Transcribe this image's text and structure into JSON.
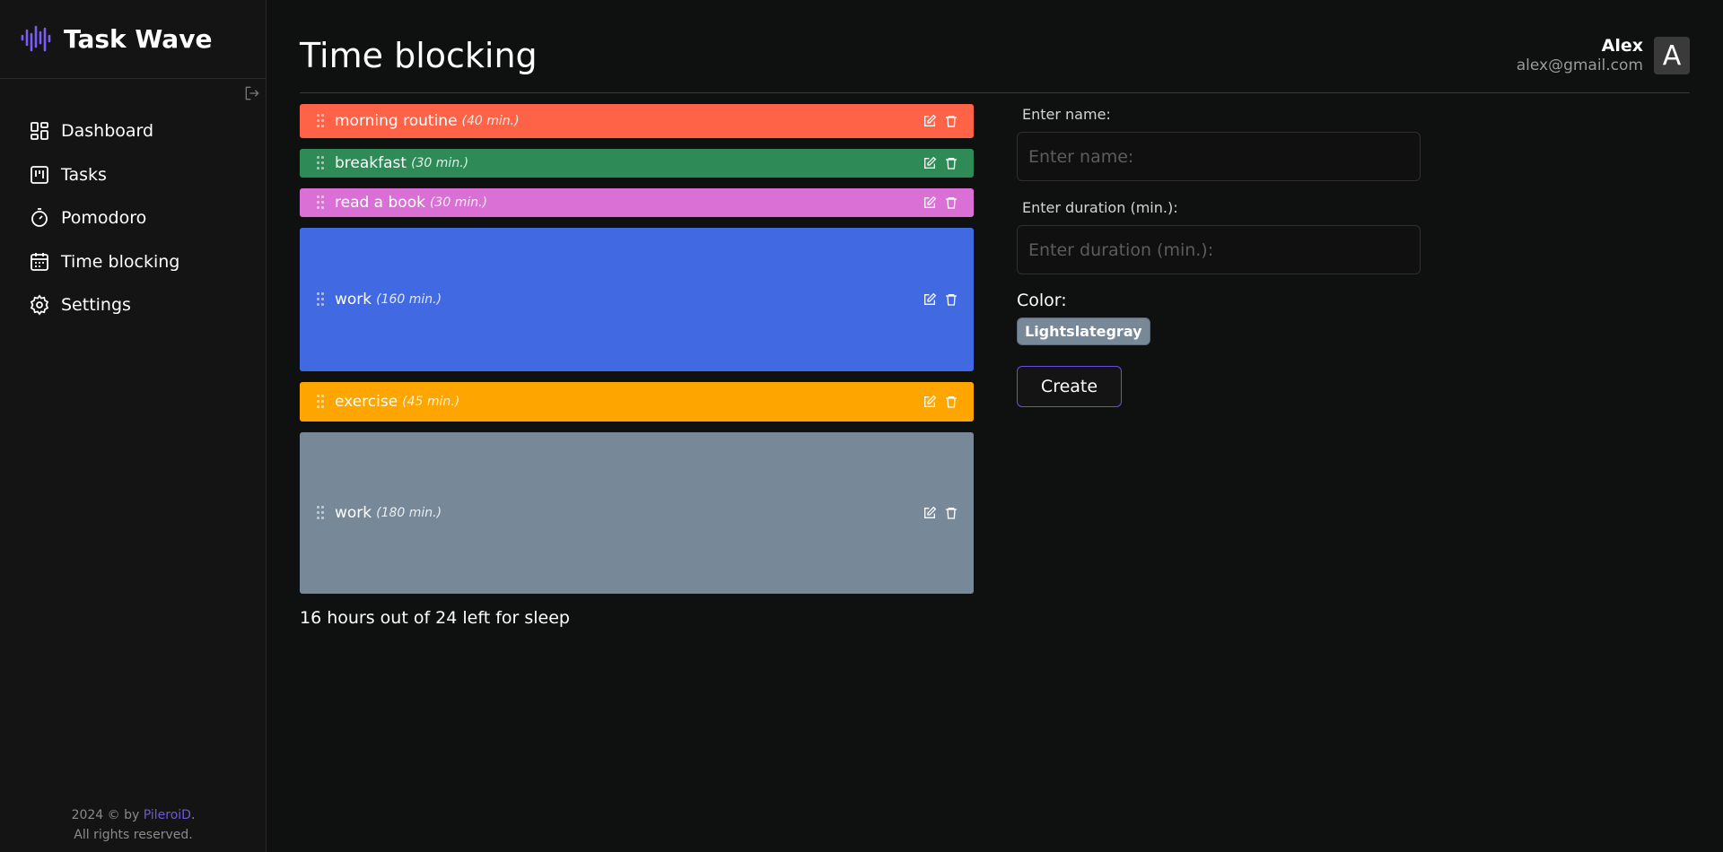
{
  "app": {
    "name": "Task Wave",
    "accent": "#7c5cf6"
  },
  "sidebar": {
    "items": [
      {
        "label": "Dashboard",
        "icon": "dashboard-icon"
      },
      {
        "label": "Tasks",
        "icon": "tasks-icon"
      },
      {
        "label": "Pomodoro",
        "icon": "timer-icon"
      },
      {
        "label": "Time blocking",
        "icon": "calendar-icon"
      },
      {
        "label": "Settings",
        "icon": "gear-icon"
      }
    ],
    "footer": {
      "prefix": "2024 © by ",
      "author": "PileroiD",
      "suffix": ".",
      "rights": "All rights reserved."
    }
  },
  "header": {
    "title": "Time blocking",
    "user": {
      "name": "Alex",
      "email": "alex@gmail.com",
      "avatar_letter": "A"
    }
  },
  "blocks": [
    {
      "name": "morning routine",
      "duration": "(40 min.)",
      "color": "#ff6347"
    },
    {
      "name": "breakfast",
      "duration": "(30 min.)",
      "color": "#2e8b57"
    },
    {
      "name": "read a book",
      "duration": "(30 min.)",
      "color": "#da70d6"
    },
    {
      "name": "work",
      "duration": "(160 min.)",
      "color": "#4169e1"
    },
    {
      "name": "exercise",
      "duration": "(45 min.)",
      "color": "#ffa500"
    },
    {
      "name": "work",
      "duration": "(180 min.)",
      "color": "#778899"
    }
  ],
  "sleep_text": "16 hours out of 24 left for sleep",
  "form": {
    "name_label": "Enter name:",
    "name_placeholder": "Enter name:",
    "duration_label": "Enter duration (min.):",
    "duration_placeholder": "Enter duration (min.):",
    "color_label": "Color:",
    "selected_color": "Lightslategray",
    "chip_close": "×",
    "create_label": "Create"
  }
}
